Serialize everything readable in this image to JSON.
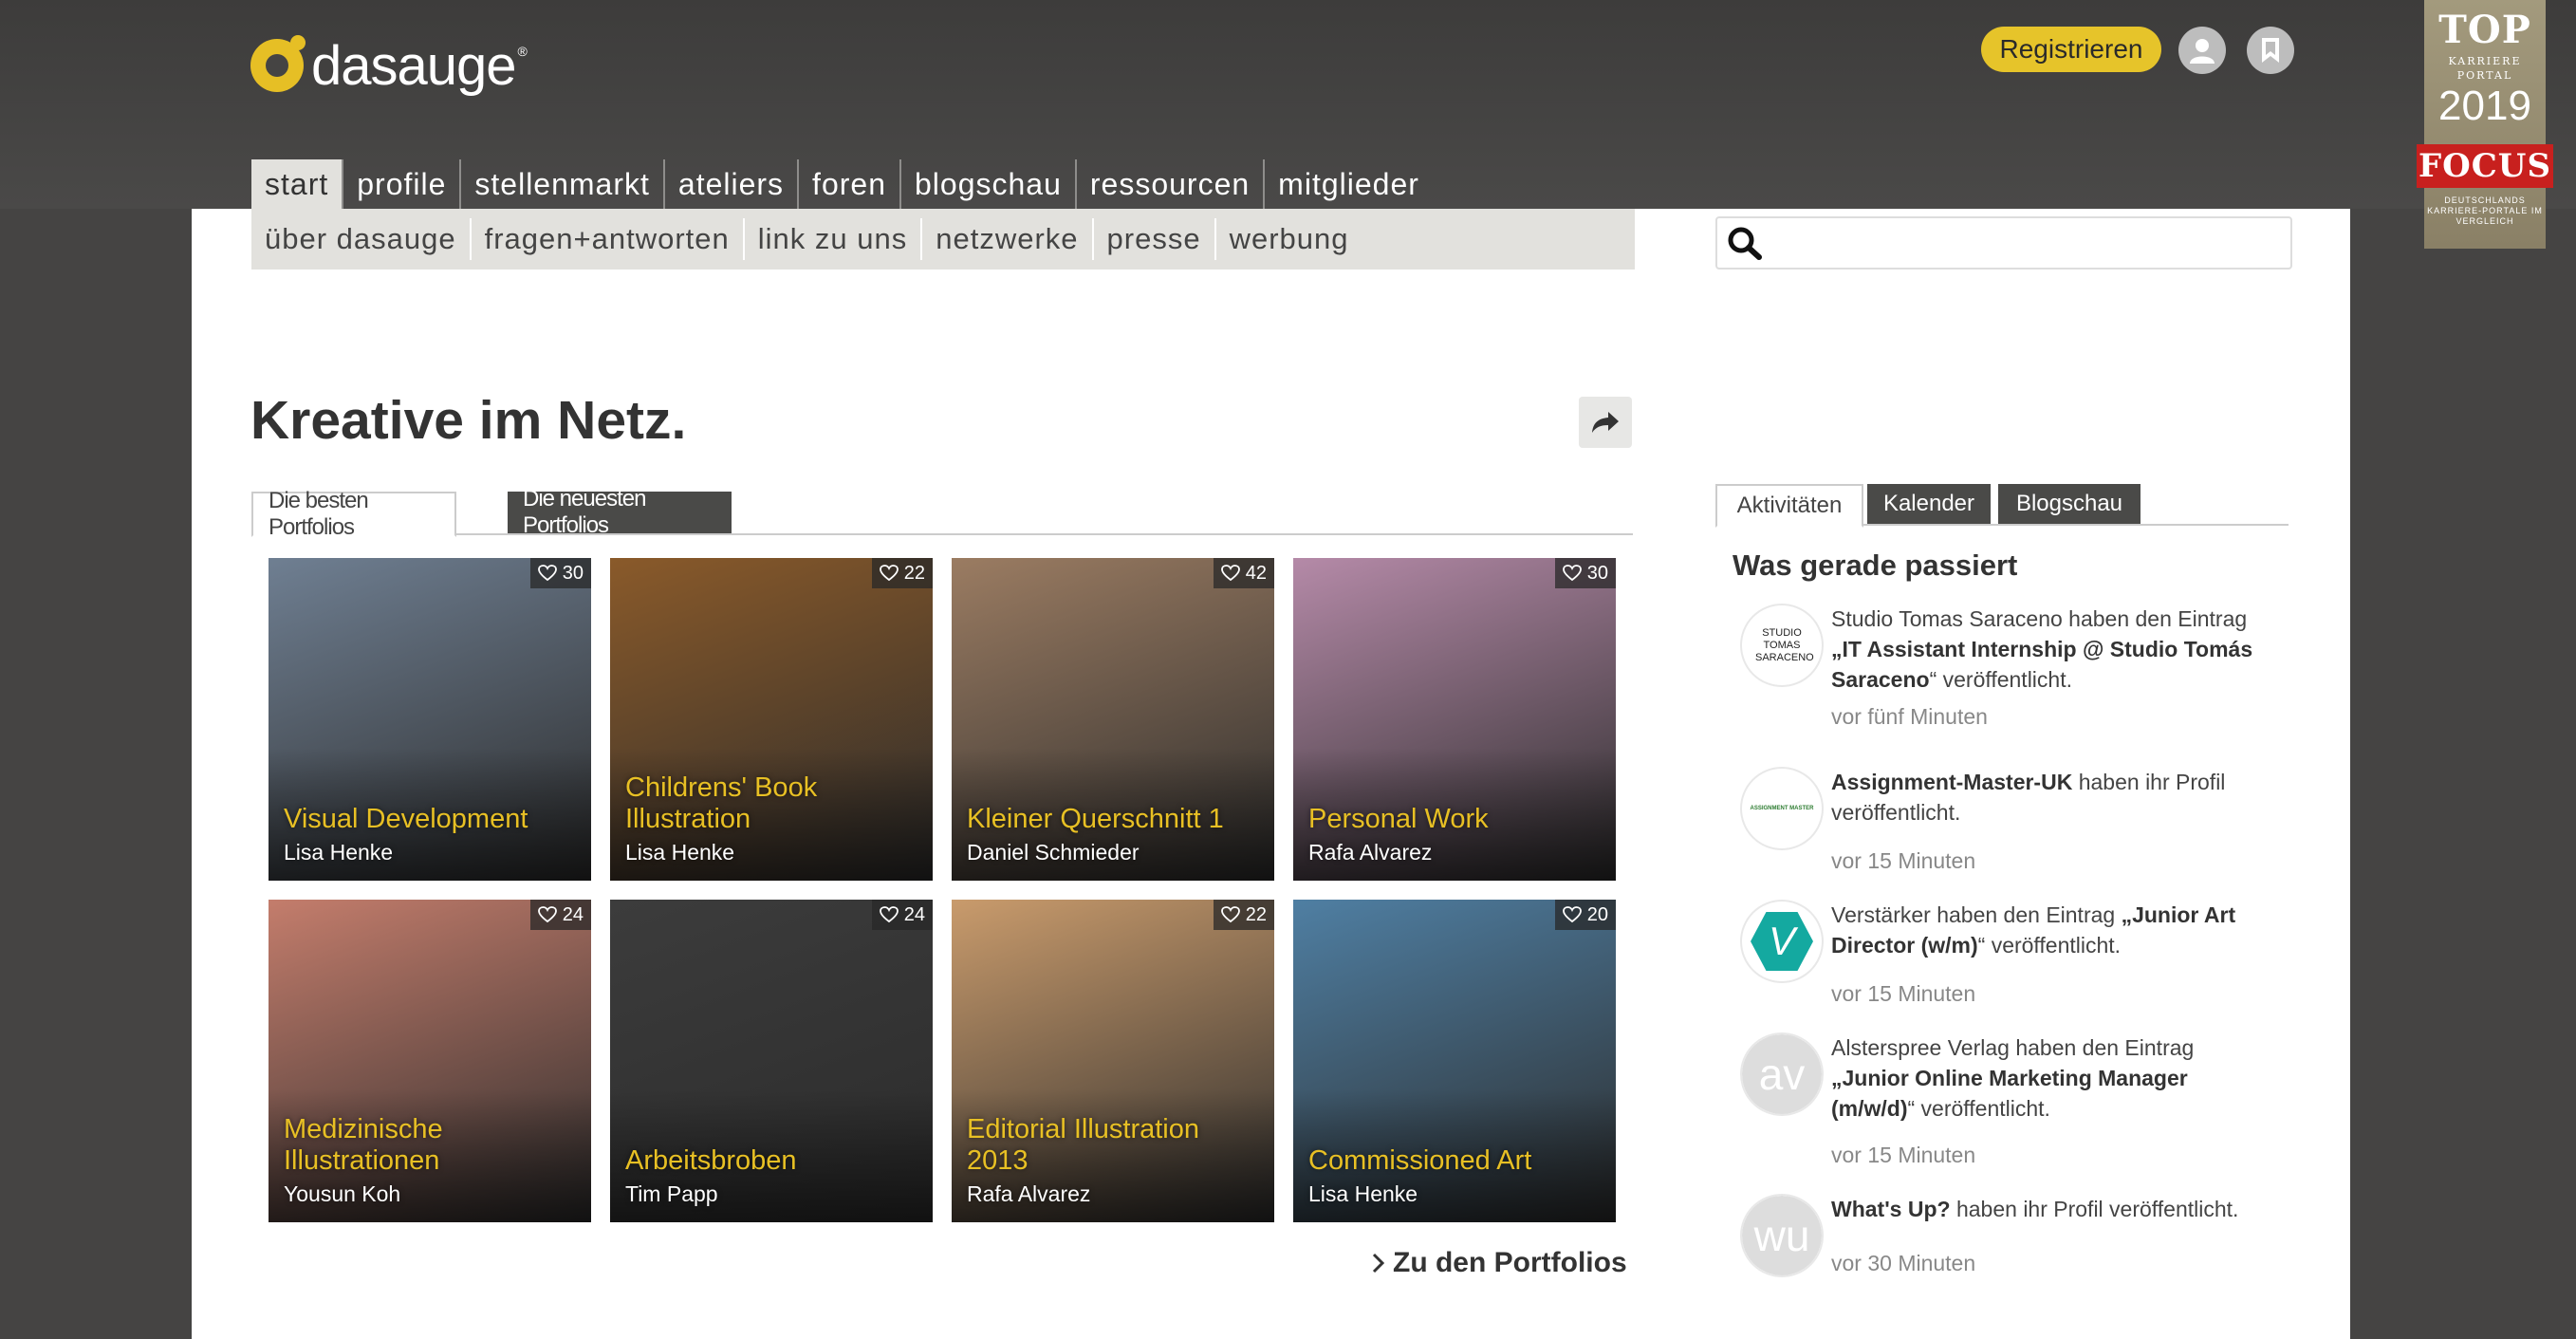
{
  "brand": {
    "name": "dasauge",
    "reg": "®"
  },
  "header": {
    "register_label": "Registrieren",
    "badge": {
      "top": "TOP",
      "sub": "KARRIERE PORTAL",
      "year": "2019",
      "focus": "FOCUS",
      "foot": "DEUTSCHLANDS KARRIERE-PORTALE IM VERGLEICH"
    }
  },
  "nav": {
    "main": [
      "start",
      "profile",
      "stellenmarkt",
      "ateliers",
      "foren",
      "blogschau",
      "ressourcen",
      "mitglieder"
    ],
    "sub": [
      "über dasauge",
      "fragen+antworten",
      "link zu uns",
      "netzwerke",
      "presse",
      "werbung"
    ]
  },
  "search": {
    "placeholder": ""
  },
  "headline": "Kreative im Netz.",
  "portfolio_tabs": [
    "Die besten Portfolios",
    "Die neuesten Portfolios"
  ],
  "portfolios": [
    {
      "title": "Visual Development",
      "author": "Lisa Henke",
      "likes": "30",
      "bg": "#6f7f92"
    },
    {
      "title": "Childrens' Book Illustration",
      "author": "Lisa Henke",
      "likes": "22",
      "bg": "#8a5a2a"
    },
    {
      "title": "Kleiner Querschnitt 1",
      "author": "Daniel Schmieder",
      "likes": "42",
      "bg": "#9b7c62"
    },
    {
      "title": "Personal Work",
      "author": "Rafa Alvarez",
      "likes": "30",
      "bg": "#b58aa8"
    },
    {
      "title": "Medizinische Illustrationen",
      "author": "Yousun Koh",
      "likes": "24",
      "bg": "#c47d6c"
    },
    {
      "title": "Arbeitsbroben",
      "author": "Tim Papp",
      "likes": "24",
      "bg": "#3c3c3c"
    },
    {
      "title": "Editorial Illustration 2013",
      "author": "Rafa Alvarez",
      "likes": "22",
      "bg": "#c99b6c"
    },
    {
      "title": "Commissioned Art",
      "author": "Lisa Henke",
      "likes": "20",
      "bg": "#4f7fa3"
    }
  ],
  "more_link": "Zu den Portfolios",
  "sidebar": {
    "tabs": [
      "Aktivitäten",
      "Kalender",
      "Blogschau"
    ],
    "title": "Was gerade passiert",
    "activities": [
      {
        "avatar": "STUDIO TOMAS SARACENO",
        "pre": "Studio Tomas Saraceno haben den Eintrag ",
        "bold": "„IT Assistant Internship @ Studio Tomás Saraceno",
        "post": "“ veröffentlicht.",
        "time": "vor fünf Minuten"
      },
      {
        "avatar": "ASSIGNMENT MASTER",
        "pre": "",
        "bold": "Assignment-Master-UK",
        "post": " haben ihr Profil veröffentlicht.",
        "time": "vor 15 Minuten"
      },
      {
        "avatar": "V",
        "pre": "Verstärker haben den Eintrag ",
        "bold": "„Junior Art Director (w/m)",
        "post": "“ veröffentlicht.",
        "time": "vor 15 Minuten"
      },
      {
        "avatar": "av",
        "pre": "Alsterspree Verlag haben den Eintrag ",
        "bold": "„Junior Online Marketing Manager (m/w/d)",
        "post": "“ veröffentlicht.",
        "time": "vor 15 Minuten"
      },
      {
        "avatar": "wu",
        "pre": "",
        "bold": "What's Up?",
        "post": " haben ihr Profil veröffentlicht.",
        "time": "vor 30 Minuten"
      }
    ]
  },
  "colors": {
    "accent": "#e6c42a",
    "dark": "#454443",
    "nav_bg": "#e2e1dd"
  }
}
